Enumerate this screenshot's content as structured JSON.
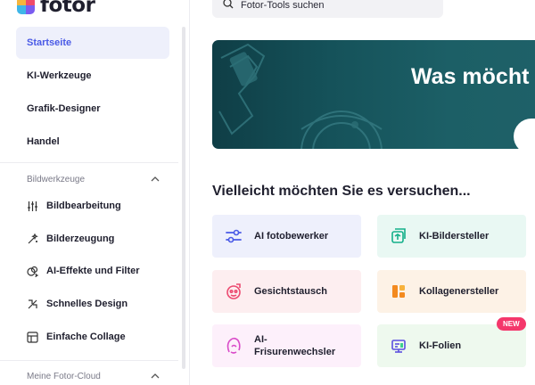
{
  "app": {
    "logo_text": "fotor"
  },
  "search": {
    "placeholder": "Fotor-Tools suchen"
  },
  "nav": {
    "items": [
      {
        "label": "Startseite",
        "active": true
      },
      {
        "label": "KI-Werkzeuge"
      },
      {
        "label": "Grafik-Designer"
      },
      {
        "label": "Handel"
      }
    ]
  },
  "sections": {
    "image_tools": {
      "title": "Bildwerkzeuge",
      "items": [
        {
          "label": "Bildbearbeitung",
          "icon": "sliders-icon"
        },
        {
          "label": "Bilderzeugung",
          "icon": "magic-wand-icon"
        },
        {
          "label": "AI-Effekte und Filter",
          "icon": "effects-icon"
        },
        {
          "label": "Schnelles Design",
          "icon": "design-icon"
        },
        {
          "label": "Einfache Collage",
          "icon": "collage-icon"
        }
      ]
    },
    "cloud": {
      "title": "Meine Fotor-Cloud"
    }
  },
  "banner": {
    "title": "Was möcht"
  },
  "try_section": {
    "title": "Vielleicht möchten Sie es versuchen...",
    "cards": [
      {
        "label": "AI fotobewerker",
        "bg": "#eef0fc",
        "icon": "adjust-icon"
      },
      {
        "label": "KI-Bildersteller",
        "bg": "#e9f8f3",
        "icon": "image-generator-icon"
      },
      {
        "label": "Gesichtstausch",
        "bg": "#fdeef0",
        "icon": "face-swap-icon"
      },
      {
        "label": "Kollagenersteller",
        "bg": "#fdf2e6",
        "icon": "collage-maker-icon"
      },
      {
        "label": "AI-Frisurenwechsler",
        "bg": "#fdf0fb",
        "icon": "hairstyle-icon"
      },
      {
        "label": "KI-Folien",
        "bg": "#eef9ee",
        "icon": "slides-icon"
      }
    ],
    "new_badge": "NEW"
  },
  "colors": {
    "accent": "#4a5ae6",
    "banner": "#15525a",
    "badge": "#f4376b"
  }
}
